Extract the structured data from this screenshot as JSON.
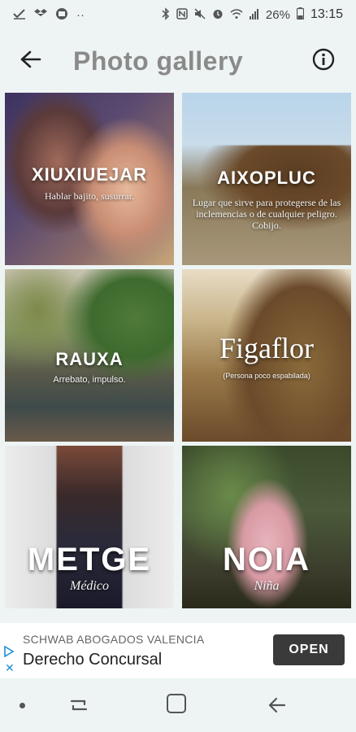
{
  "status_bar": {
    "battery_percent": "26%",
    "time": "13:15",
    "left_icons": [
      "check-icon",
      "dropbox-icon",
      "tv-icon",
      "more-dots-icon"
    ],
    "right_icons": [
      "bluetooth-icon",
      "nfc-icon",
      "mute-icon",
      "alarm-icon",
      "wifi-icon",
      "signal-icon",
      "battery-icon"
    ]
  },
  "app_bar": {
    "title": "Photo gallery",
    "back_icon": "arrow-left-icon",
    "info_icon": "info-icon"
  },
  "gallery": {
    "tiles": [
      {
        "word": "XIUXIUEJAR",
        "definition": "Hablar bajito, susurrar."
      },
      {
        "word": "AIXOPLUC",
        "definition": "Lugar que sirve para protegerse de las inclemencias o de cualquier peligro. Cobijo."
      },
      {
        "word": "RAUXA",
        "definition": "Arrebato, impulso."
      },
      {
        "word": "Figaflor",
        "definition": "(Persona poco espabilada)"
      },
      {
        "word": "METGE",
        "definition": "Médico"
      },
      {
        "word": "NOIA",
        "definition": "Niña"
      }
    ]
  },
  "ad": {
    "sponsor": "SCHWAB ABOGADOS VALENCIA",
    "title": "Derecho Concursal",
    "button": "OPEN",
    "ad_choices_icon": "ad-play-icon",
    "close_icon": "close-icon"
  },
  "nav_bar": {
    "icons": [
      "nav-dot-icon",
      "recent-apps-icon",
      "home-icon",
      "back-icon"
    ]
  },
  "colors": {
    "background": "#eef4f4",
    "title": "#8a8a8a",
    "ad_button": "#3a3a3a",
    "ad_accent": "#1a8fd6"
  }
}
